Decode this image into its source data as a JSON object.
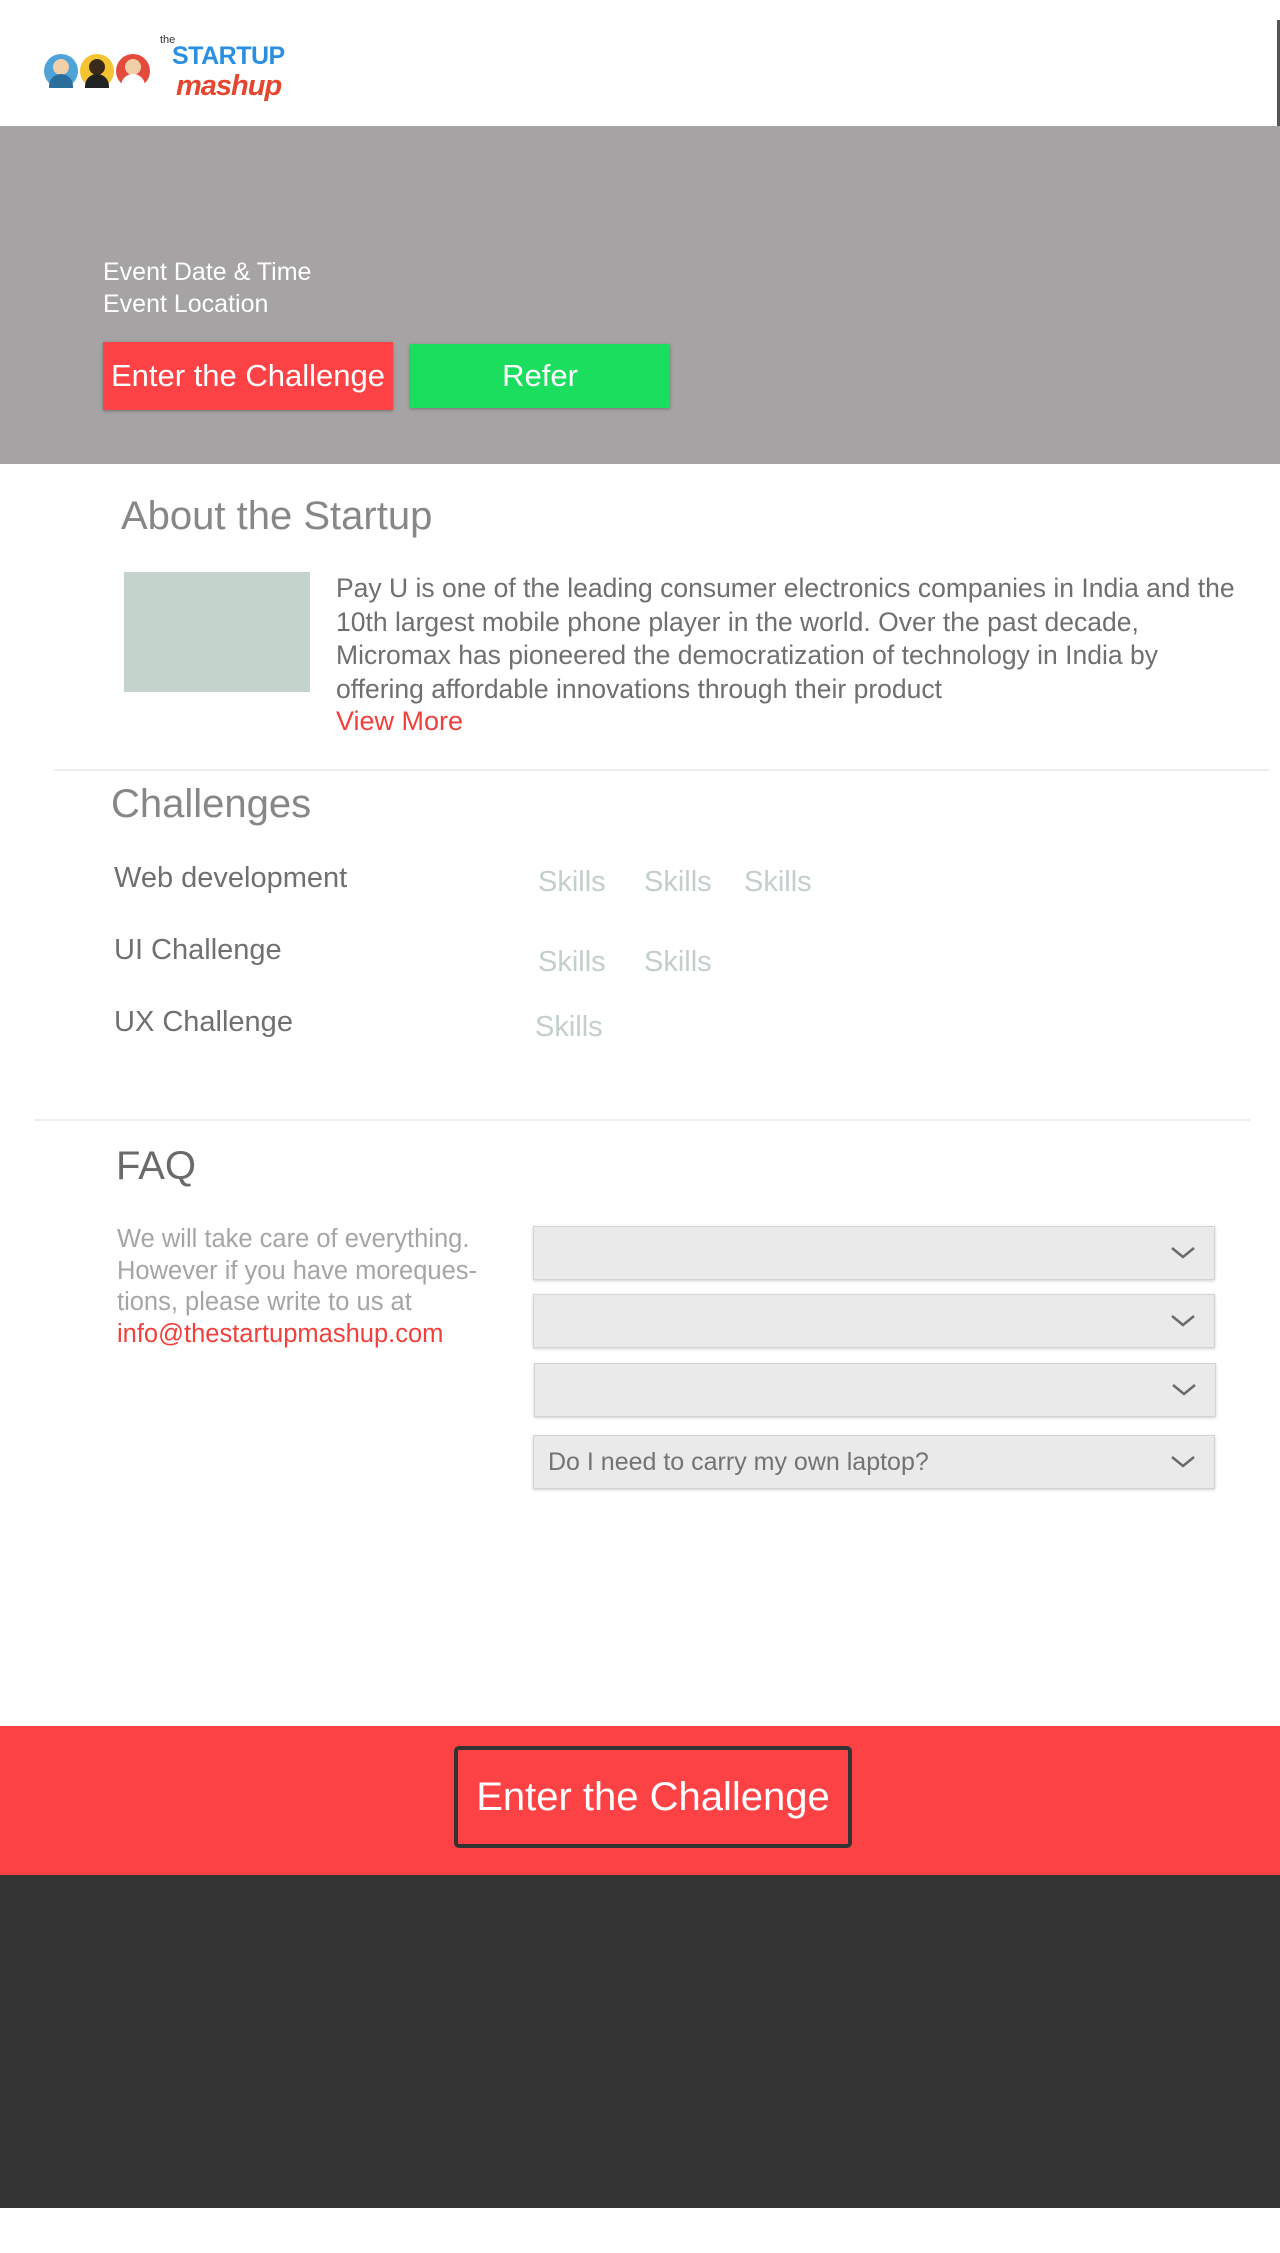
{
  "header": {
    "logo": {
      "prefix": "the",
      "word1": "STARTUP",
      "word2": "mashup"
    }
  },
  "hero": {
    "event_date": "Event Date & Time",
    "event_location": "Event Location",
    "enter_label": "Enter the Challenge",
    "refer_label": "Refer"
  },
  "about": {
    "title": "About the Startup",
    "description": "Pay U is one of the leading consumer electronics companies in India and the 10th largest mobile phone player in the world. Over the past decade, Micromax has pioneered the democratization of technology in India by offering affordable innovations through their product",
    "view_more": "View More"
  },
  "challenges": {
    "title": "Challenges",
    "items": [
      {
        "name": "Web development",
        "skills": [
          "Skills",
          "Skills",
          "Skills"
        ]
      },
      {
        "name": "UI Challenge",
        "skills": [
          "Skills",
          "Skills"
        ]
      },
      {
        "name": "UX Challenge",
        "skills": [
          "Skills"
        ]
      }
    ]
  },
  "faq": {
    "title": "FAQ",
    "intro": "We will take care of everything. However if you have morequestions, please write to us at",
    "intro_lines": [
      "We will take care of everything.",
      "However if you have moreques-",
      "tions, please write to us at"
    ],
    "email": "info@thestartupmashup.com",
    "questions": [
      "",
      "",
      "",
      "Do I need to carry my own laptop?"
    ]
  },
  "cta": {
    "label": "Enter the Challenge"
  },
  "colors": {
    "accent_red": "#fd4245",
    "refer_green": "#1bde5e",
    "hero_gray": "#a5a3a4",
    "footer_dark": "#353535"
  },
  "icons": [
    "avatar-icons",
    "chevron-down-icon"
  ]
}
